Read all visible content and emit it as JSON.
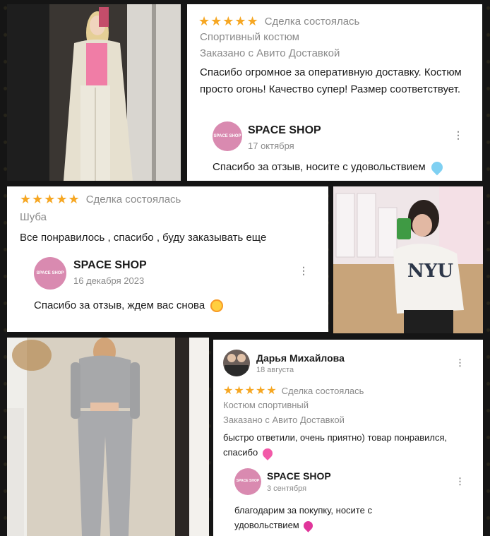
{
  "review1": {
    "stars": "★★★★★",
    "deal_status": "Сделка состоялась",
    "product": "Спортивный костюм",
    "delivery": "Заказано с Авито Доставкой",
    "text": "Спасибо огромное за оперативную доставку. Костюм просто огонь! Качество супер! Размер соответствует.",
    "reply": {
      "logo_text": "SPACE SHOP",
      "seller": "SPACE SHOP",
      "date": "17 октября",
      "text": "Спасибо за отзыв, носите с удовольствием"
    }
  },
  "review2": {
    "stars": "★★★★★",
    "deal_status": "Сделка состоялась",
    "product": "Шуба",
    "text": "Все понравилось , спасибо , буду заказывать еще",
    "reply": {
      "logo_text": "SPACE SHOP",
      "seller": "SPACE SHOP",
      "date": "16 декабря 2023",
      "text": "Спасибо за отзыв, ждем вас снова"
    }
  },
  "review3": {
    "author": "Дарья Михайлова",
    "author_date": "18 августа",
    "stars": "★★★★★",
    "deal_status": "Сделка состоялась",
    "product": "Костюм спортивный",
    "delivery": "Заказано с Авито Доставкой",
    "text": "быстро ответили, очень приятно) товар понравился, спасибо",
    "reply": {
      "logo_text": "SPACE SHOP",
      "seller": "SPACE SHOP",
      "date": "3 сентября",
      "text": "благодарим за покупку, носите с удовольствием"
    }
  },
  "colors": {
    "stars": "#f6a723",
    "logo_bg": "#d98ab0",
    "muted": "#8a8a8a",
    "background": "#151515"
  },
  "icons": [
    "star-icon",
    "kebab-menu-icon",
    "heart-emoji",
    "smiling-face-with-hearts-emoji",
    "sparkling-heart-emoji"
  ]
}
